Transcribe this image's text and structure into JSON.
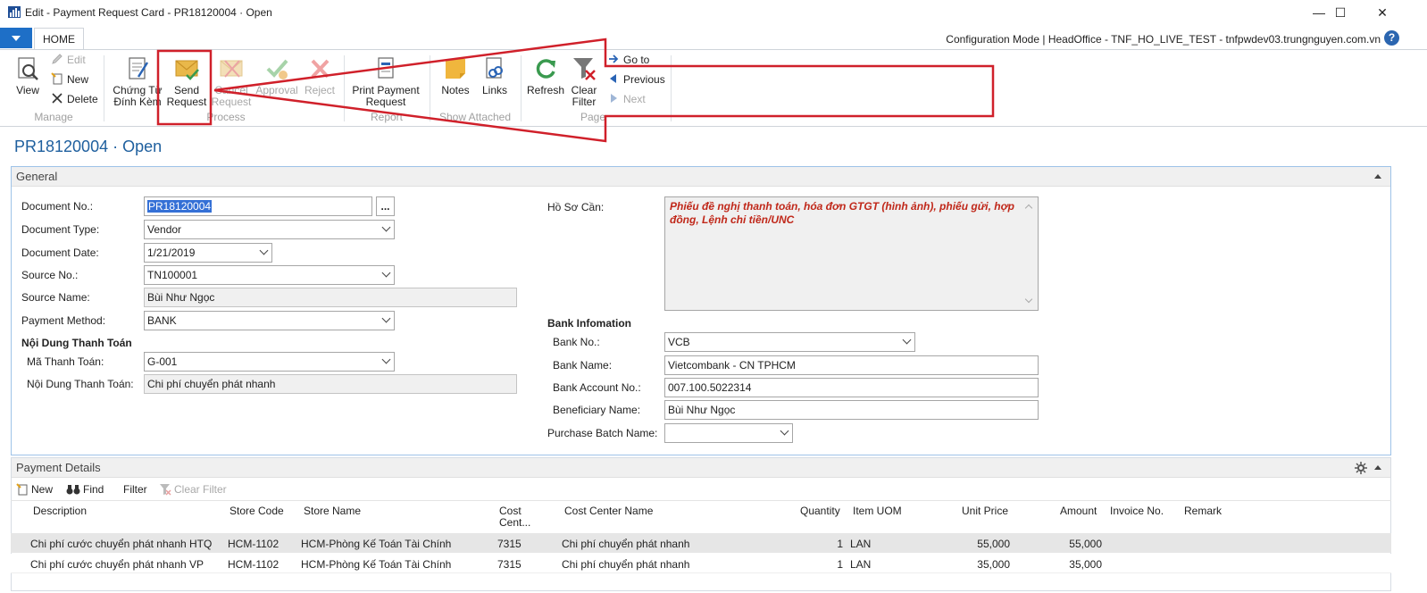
{
  "window": {
    "title": "Edit - Payment Request Card - PR18120004 · Open",
    "minimize": "—",
    "maximize": "☐",
    "close": "✕"
  },
  "ribbon_tabs": {
    "home": "HOME",
    "config_info": "Configuration Mode | HeadOffice - TNF_HO_LIVE_TEST - tnfpwdev03.trungnguyen.com.vn",
    "help": "?"
  },
  "ribbon": {
    "manage": {
      "group": "Manage",
      "view": "View",
      "edit": "Edit",
      "new": "New",
      "delete": "Delete"
    },
    "process": {
      "group": "Process",
      "chung_tu_1": "Chứng Từ",
      "chung_tu_2": "Đính Kèm",
      "send_1": "Send",
      "send_2": "Request",
      "cancel_1": "Cancel",
      "cancel_2": "Request",
      "approval": "Approval",
      "reject": "Reject"
    },
    "report": {
      "group": "Report",
      "print_1": "Print Payment",
      "print_2": "Request"
    },
    "show_attached": {
      "group": "Show Attached",
      "notes": "Notes",
      "links": "Links"
    },
    "page": {
      "group": "Page",
      "refresh": "Refresh",
      "clear_1": "Clear",
      "clear_2": "Filter",
      "goto": "Go to",
      "previous": "Previous",
      "next": "Next"
    }
  },
  "page_title": "PR18120004 · Open",
  "general": {
    "caption": "General",
    "fields": {
      "document_no_label": "Document No.:",
      "document_no": "PR18120004",
      "assist": "...",
      "document_type_label": "Document Type:",
      "document_type": "Vendor",
      "document_date_label": "Document Date:",
      "document_date": "1/21/2019",
      "source_no_label": "Source No.:",
      "source_no": "TN100001",
      "source_name_label": "Source Name:",
      "source_name": "Bùi Như Ngọc",
      "payment_method_label": "Payment Method:",
      "payment_method": "BANK",
      "noi_dung_header": "Nội Dung Thanh Toán",
      "ma_thanh_toan_label": "Mã Thanh Toán:",
      "ma_thanh_toan": "G-001",
      "noi_dung_label": "Nội Dung Thanh Toán:",
      "noi_dung": "Chi phí chuyển phát nhanh",
      "ho_so_can_label": "Hồ Sơ Cần:",
      "ho_so_can": "Phiếu đề nghị thanh toán, hóa đơn GTGT (hình ảnh), phiếu gửi, hợp đồng, Lệnh chi tiền/UNC",
      "bank_header": "Bank Infomation",
      "bank_no_label": "Bank No.:",
      "bank_no": "VCB",
      "bank_name_label": "Bank Name:",
      "bank_name": "Vietcombank - CN TPHCM",
      "bank_account_label": "Bank Account No.:",
      "bank_account": "007.100.5022314",
      "beneficiary_label": "Beneficiary Name:",
      "beneficiary": "Bùi Như Ngọc",
      "batch_label": "Purchase Batch Name:",
      "batch": ""
    }
  },
  "payment_details": {
    "caption": "Payment Details",
    "toolbar": {
      "new": "New",
      "find": "Find",
      "filter": "Filter",
      "clear_filter": "Clear Filter"
    },
    "columns": {
      "description": "Description",
      "store_code": "Store Code",
      "store_name": "Store Name",
      "cost_center_1": "Cost",
      "cost_center_2": "Cent...",
      "cost_center_name": "Cost Center Name",
      "quantity": "Quantity",
      "item_uom": "Item UOM",
      "unit_price": "Unit Price",
      "amount": "Amount",
      "invoice_no": "Invoice No.",
      "remark": "Remark"
    },
    "rows": [
      {
        "description": "Chi phí cước chuyển phát nhanh HTQ",
        "store_code": "HCM-1102",
        "store_name": "HCM-Phòng Kế Toán Tài Chính",
        "cost_center": "7315",
        "cost_center_name": "Chi phí chuyển phát nhanh",
        "quantity": "1",
        "item_uom": "LAN",
        "unit_price": "55,000",
        "amount": "55,000"
      },
      {
        "description": "Chi phí cước chuyển phát nhanh VP",
        "store_code": "HCM-1102",
        "store_name": "HCM-Phòng Kế Toán Tài Chính",
        "cost_center": "7315",
        "cost_center_name": "Chi phí chuyển phát nhanh",
        "quantity": "1",
        "item_uom": "LAN",
        "unit_price": "35,000",
        "amount": "35,000"
      }
    ]
  },
  "colors": {
    "accent": "#1e6fc7",
    "title_blue": "#1e5f9e",
    "annotation_red": "#d0202a",
    "memo_text": "#c0281a"
  }
}
